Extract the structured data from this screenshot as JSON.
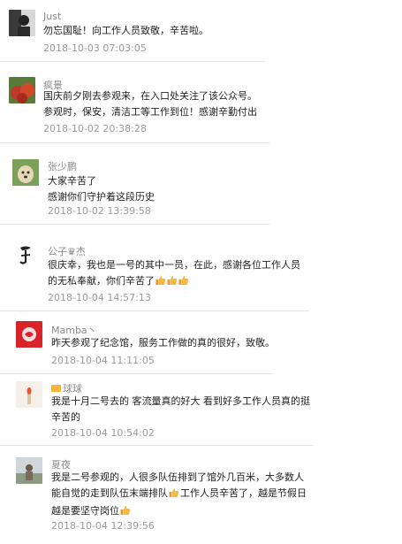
{
  "comments": [
    {
      "nickname": "Just",
      "lines": [
        "勿忘国耻！向工作人员致敬，辛苦啦。"
      ],
      "time": "2018-10-03 07:03:05",
      "avatar": "portrait-bw-avatar"
    },
    {
      "nickname": "疯景",
      "lines": [
        "国庆前夕刚去参观来，在入口处关注了该公众号。",
        "参观时，保安，清洁工等工作到位！感谢辛勤付出"
      ],
      "time": "2018-10-02 20:38:28",
      "avatar": "red-fruit-avatar"
    },
    {
      "nickname": "张少鹏",
      "lines": [
        "大家辛苦了",
        "感谢你们守护着这段历史"
      ],
      "time": "2018-10-02 13:39:58",
      "avatar": "dog-avatar"
    },
    {
      "nickname": "公子♛杰",
      "lines": [
        "很庆幸，我也是一号的其中一员，在此，感谢各位工作人员",
        "的无私奉献，你们辛苦了"
      ],
      "thumbs_after_line": 1,
      "thumbs_count": 3,
      "time": "2018-10-04 14:57:13",
      "avatar": "calligraphy-avatar"
    },
    {
      "nickname": "Mamba丶",
      "lines": [
        "昨天参观了纪念馆，服务工作做的真的很好，致敬。"
      ],
      "time": "2018-10-04 11:11:05",
      "avatar": "red-emblem-avatar"
    },
    {
      "nickname": "球球",
      "lines": [
        "我是十月二号去的 客流量真的好大 看到好多工作人员真的挺",
        "辛苦的"
      ],
      "time": "2018-10-04 10:54:02",
      "avatar": "candle-avatar",
      "badge": "yellow-badge-icon"
    },
    {
      "nickname": "夏夜",
      "lines": [
        "我是二号参观的，人很多队伍排到了馆外几百米，大多数人",
        "能自觉的走到队伍末端排队",
        "工作人员辛苦了，越是节假日",
        "越是要坚守岗位"
      ],
      "time": "2018-10-04 12:39:56",
      "avatar": "outdoor-photo-avatar"
    }
  ]
}
